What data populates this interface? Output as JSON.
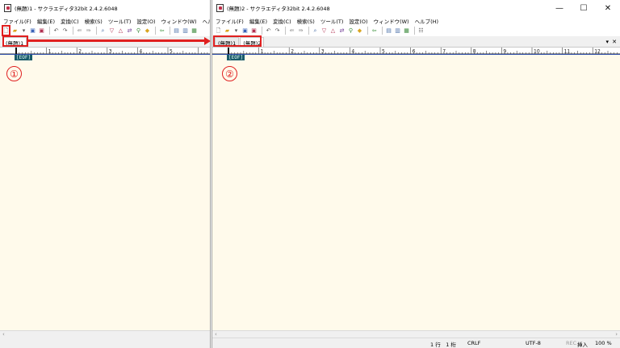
{
  "windows": [
    {
      "title": "(無題)1 - サクラエディタ32bit 2.4.2.6048",
      "menu": [
        "ファイル(F)",
        "編集(E)",
        "変換(C)",
        "検索(S)",
        "ツール(T)",
        "設定(O)",
        "ウィンドウ(W)",
        "ヘルプ(H)"
      ],
      "tabs": [
        "(無題)1"
      ],
      "eof": "[EOF]"
    },
    {
      "title": "(無題)2 - サクラエディタ32bit 2.4.2.6048",
      "menu": [
        "ファイル(F)",
        "編集(E)",
        "変換(C)",
        "検索(S)",
        "ツール(T)",
        "設定(O)",
        "ウィンドウ(W)",
        "ヘルプ(H)"
      ],
      "tabs": [
        "(無題)1",
        "(無題)2"
      ],
      "eof": "[EOF]",
      "tab_controls": {
        "dropdown": "▾",
        "close": "✕"
      },
      "window_buttons": {
        "minimize": "—",
        "maximize": "☐",
        "close": "✕"
      },
      "status": {
        "position": "1 行　1 桁",
        "line_ending": "CRLF",
        "encoding": "UTF-8",
        "rec": "REC",
        "insert_mode": "挿入",
        "zoom": "100 %"
      }
    }
  ],
  "ruler_labels": [
    "1",
    "2",
    "3",
    "4",
    "5",
    "6",
    "7",
    "8",
    "9",
    "10",
    "11",
    "12"
  ],
  "annotations": {
    "step1": "①",
    "step2": "②"
  },
  "accent_color": "#e02020",
  "editor_bg": "#fffaeb"
}
